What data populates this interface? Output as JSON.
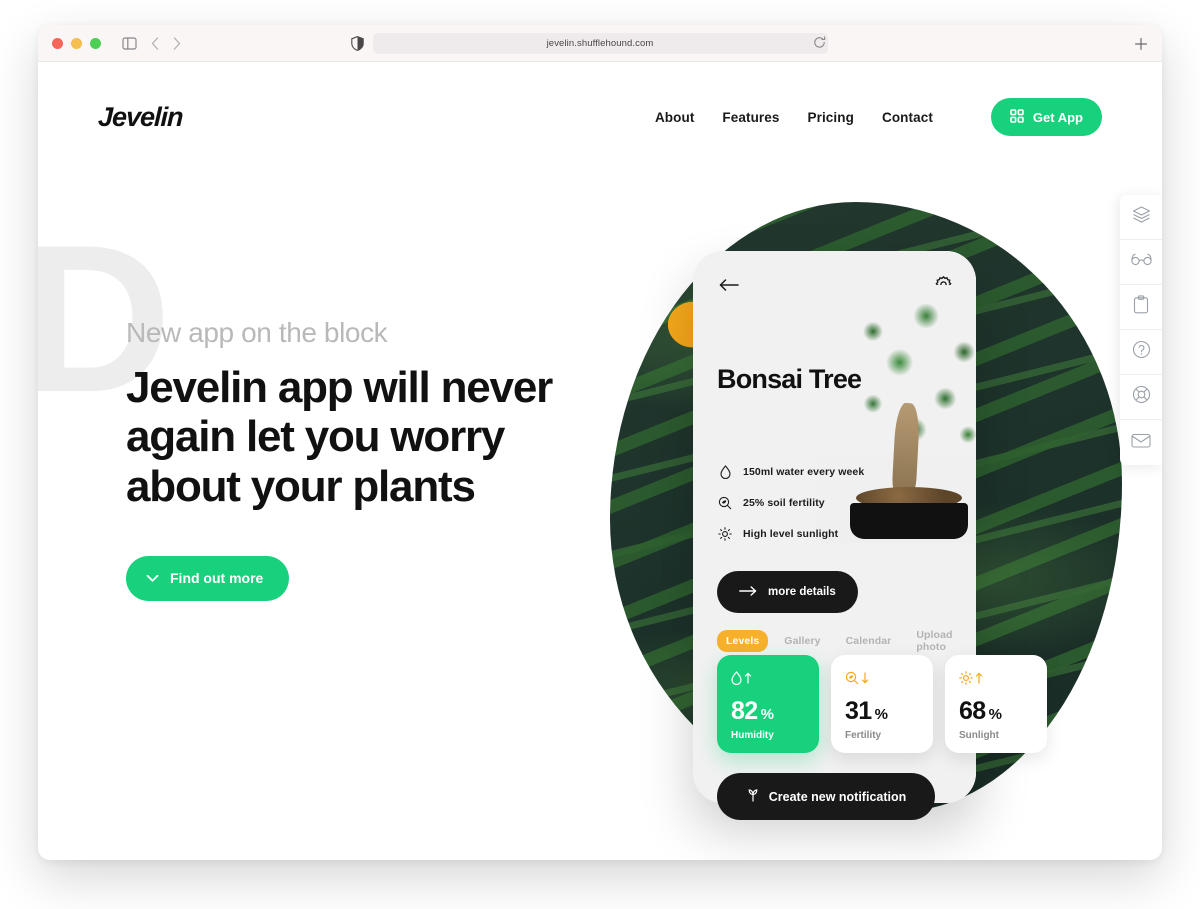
{
  "browser": {
    "url": "jevelin.shufflehound.com",
    "traffic_lights": [
      "close",
      "minimize",
      "maximize"
    ],
    "icons": {
      "sidebar": "sidebar-toggle-icon",
      "back": "back-chevron-icon",
      "forward": "forward-chevron-icon",
      "shield": "privacy-shield-icon",
      "reload": "reload-icon",
      "newtab": "new-tab-plus-icon"
    }
  },
  "header": {
    "logo": "Jevelin",
    "nav": [
      {
        "label": "About"
      },
      {
        "label": "Features"
      },
      {
        "label": "Pricing"
      },
      {
        "label": "Contact"
      }
    ],
    "cta": {
      "label": "Get App",
      "icon": "grid-icon",
      "color": "#17d17c"
    }
  },
  "hero": {
    "eyebrow": "New app on the block",
    "headline": "Jevelin app will never again let you worry about your plants",
    "decorative_letter": "D",
    "button": {
      "label": "Find out more",
      "icon": "chevron-down-icon",
      "color": "#17d17c"
    }
  },
  "phone": {
    "back_icon": "arrow-left-icon",
    "settings_icon": "gear-icon",
    "plant_title": "Bonsai Tree",
    "stats": [
      {
        "icon": "water-drop-icon",
        "text": "150ml water every week"
      },
      {
        "icon": "soil-fertility-icon",
        "text": "25% soil fertility"
      },
      {
        "icon": "sun-icon",
        "text": "High level sunlight"
      }
    ],
    "more_details": {
      "label": "more details",
      "icon": "arrow-right-icon"
    },
    "tabs": [
      {
        "label": "Levels",
        "active": true
      },
      {
        "label": "Gallery",
        "active": false
      },
      {
        "label": "Calendar",
        "active": false
      },
      {
        "label": "Upload photo",
        "active": false
      }
    ],
    "metrics": [
      {
        "value": "82",
        "unit": "%",
        "label": "Humidity",
        "icon": "water-drop-icon",
        "trend": "up",
        "highlight": true
      },
      {
        "value": "31",
        "unit": "%",
        "label": "Fertility",
        "icon": "soil-fertility-icon",
        "trend": "down",
        "highlight": false
      },
      {
        "value": "68",
        "unit": "%",
        "label": "Sunlight",
        "icon": "sun-icon",
        "trend": "up",
        "highlight": false
      }
    ],
    "notification_button": {
      "label": "Create new notification",
      "icon": "sprout-icon"
    }
  },
  "rail": [
    {
      "icon": "layers-icon"
    },
    {
      "icon": "glasses-icon"
    },
    {
      "icon": "clipboard-icon"
    },
    {
      "icon": "help-circle-icon"
    },
    {
      "icon": "lifebuoy-icon"
    },
    {
      "icon": "mail-icon"
    }
  ],
  "colors": {
    "accent_green": "#17d17c",
    "accent_orange": "#f7a81b",
    "tab_active": "#f7b02b",
    "dark": "#191919"
  }
}
